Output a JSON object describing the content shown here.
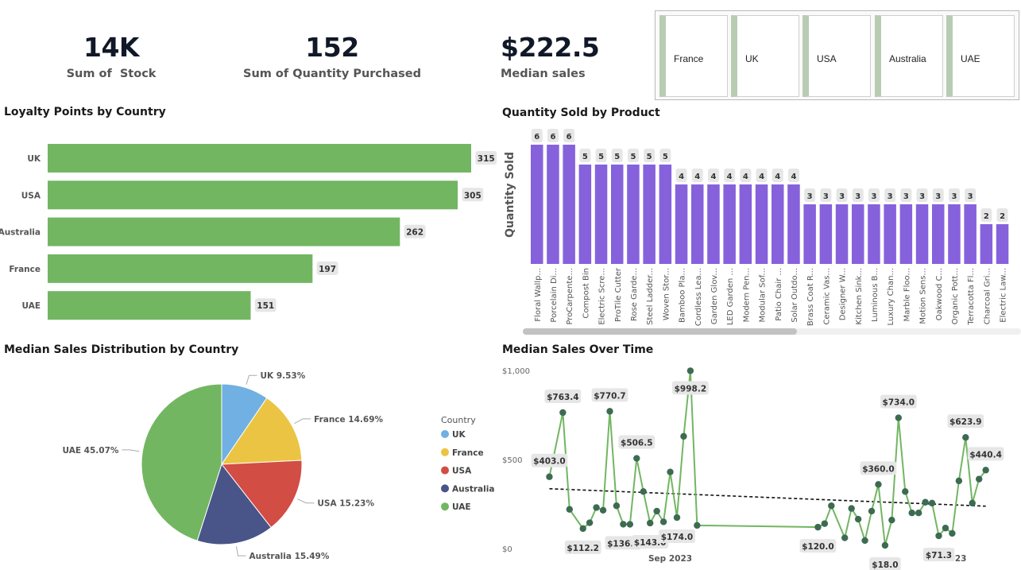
{
  "kpis": {
    "stock": {
      "value": "14K",
      "label": "Sum of  Stock"
    },
    "quantity": {
      "value": "152",
      "label": "Sum of Quantity Purchased"
    },
    "median": {
      "value": "$222.5",
      "label": "Median sales"
    }
  },
  "slicer": {
    "items": [
      "France",
      "UK",
      "USA",
      "Australia",
      "UAE"
    ]
  },
  "loyalty": {
    "title": "Loyalty Points by Country",
    "chart_data": {
      "type": "bar",
      "orientation": "horizontal",
      "categories": [
        "UK",
        "USA",
        "Australia",
        "France",
        "UAE"
      ],
      "values": [
        315,
        305,
        262,
        197,
        151
      ],
      "data_labels": [
        "315",
        "305",
        "262",
        "197",
        "151"
      ],
      "color": "#72b662",
      "xlim": [
        0,
        315
      ]
    }
  },
  "quantity_chart": {
    "title": "Quantity Sold by Product",
    "ylabel": "Quantity Sold",
    "chart_data": {
      "type": "bar",
      "categories": [
        "Floral Wallp...",
        "Porcelain Di...",
        "ProCarpente...",
        "Compost Bin",
        "Electric Scre...",
        "ProTile Cutter",
        "Rose Garde...",
        "Steel Ladder...",
        "Woven Stor...",
        "Bamboo Pla...",
        "Cordless Lea...",
        "Garden Glov...",
        "LED Garden ...",
        "Modern Pen...",
        "Modular Sof...",
        "Patio Chair ...",
        "Solar Outdo...",
        "Brass Coat R...",
        "Ceramic Vas...",
        "Designer W...",
        "Kitchen Sink...",
        "Luminous B...",
        "Luxury Chan...",
        "Marble Floo...",
        "Motion Sens...",
        "Oakwood C...",
        "Organic Pott...",
        "Terracotta Fl...",
        "Charcoal Gri...",
        "Electric Law..."
      ],
      "values": [
        6,
        6,
        6,
        5,
        5,
        5,
        5,
        5,
        5,
        4,
        4,
        4,
        4,
        4,
        4,
        4,
        4,
        3,
        3,
        3,
        3,
        3,
        3,
        3,
        3,
        3,
        3,
        3,
        2,
        2
      ],
      "color": "#8661dc",
      "ylim": [
        0,
        6
      ]
    }
  },
  "pie_chart": {
    "title": "Median Sales Distribution by Country",
    "legend_title": "Country",
    "chart_data": {
      "type": "pie",
      "legend_position": "right",
      "slices": [
        {
          "name": "UK",
          "value": 9.53,
          "label": "UK 9.53%",
          "color": "#71b0e2"
        },
        {
          "name": "France",
          "value": 14.69,
          "label": "France 14.69%",
          "color": "#ecc443"
        },
        {
          "name": "USA",
          "value": 15.23,
          "label": "USA 15.23%",
          "color": "#d24d44"
        },
        {
          "name": "Australia",
          "value": 15.49,
          "label": "Australia 15.49%",
          "color": "#495488"
        },
        {
          "name": "UAE",
          "value": 45.07,
          "label": "UAE 45.07%",
          "color": "#72b662"
        }
      ]
    }
  },
  "line_chart": {
    "title": "Median Sales Over Time",
    "chart_data": {
      "type": "line",
      "y_ticks": [
        "$1,000",
        "$500",
        "$0"
      ],
      "x_ticks": [
        "Sep 2023",
        "Oct 2023"
      ],
      "ylim": [
        0,
        1000
      ],
      "xlim": [
        "2023-08-20",
        "2023-10-28"
      ],
      "line_color": "#72b662",
      "marker_color": "#3d6b52",
      "trend": {
        "start": 336,
        "end": 238,
        "color": "#111111"
      },
      "points": [
        {
          "date": "2023-08-21",
          "value": 403.0,
          "label": "$403.0"
        },
        {
          "date": "2023-08-23",
          "value": 763.4,
          "label": "$763.4"
        },
        {
          "date": "2023-08-24",
          "value": 220
        },
        {
          "date": "2023-08-26",
          "value": 112.2,
          "label": "$112.2"
        },
        {
          "date": "2023-08-27",
          "value": 145
        },
        {
          "date": "2023-08-28",
          "value": 230
        },
        {
          "date": "2023-08-29",
          "value": 215
        },
        {
          "date": "2023-08-30",
          "value": 770.7,
          "label": "$770.7"
        },
        {
          "date": "2023-08-31",
          "value": 240
        },
        {
          "date": "2023-09-01",
          "value": 136.5,
          "label": "$136.5"
        },
        {
          "date": "2023-09-02",
          "value": 136
        },
        {
          "date": "2023-09-03",
          "value": 506.5,
          "label": "$506.5"
        },
        {
          "date": "2023-09-04",
          "value": 320
        },
        {
          "date": "2023-09-05",
          "value": 143.0,
          "label": "$143.0"
        },
        {
          "date": "2023-09-06",
          "value": 210
        },
        {
          "date": "2023-09-07",
          "value": 150
        },
        {
          "date": "2023-09-08",
          "value": 430
        },
        {
          "date": "2023-09-09",
          "value": 174.0,
          "label": "$174.0"
        },
        {
          "date": "2023-09-10",
          "value": 630
        },
        {
          "date": "2023-09-11",
          "value": 998.2,
          "label": "$998.2"
        },
        {
          "date": "2023-09-12",
          "value": 130
        },
        {
          "date": "2023-09-30",
          "value": 120.0,
          "label": "$120.0"
        },
        {
          "date": "2023-10-01",
          "value": 140
        },
        {
          "date": "2023-10-02",
          "value": 240
        },
        {
          "date": "2023-10-04",
          "value": 60
        },
        {
          "date": "2023-10-05",
          "value": 225
        },
        {
          "date": "2023-10-06",
          "value": 165
        },
        {
          "date": "2023-10-07",
          "value": 45
        },
        {
          "date": "2023-10-08",
          "value": 210
        },
        {
          "date": "2023-10-09",
          "value": 360.0,
          "label": "$360.0"
        },
        {
          "date": "2023-10-10",
          "value": 18.0,
          "label": "$18.0"
        },
        {
          "date": "2023-10-11",
          "value": 160
        },
        {
          "date": "2023-10-12",
          "value": 734.0,
          "label": "$734.0"
        },
        {
          "date": "2023-10-13",
          "value": 320
        },
        {
          "date": "2023-10-14",
          "value": 200
        },
        {
          "date": "2023-10-15",
          "value": 200
        },
        {
          "date": "2023-10-16",
          "value": 260
        },
        {
          "date": "2023-10-17",
          "value": 255
        },
        {
          "date": "2023-10-18",
          "value": 71.3,
          "label": "$71.3"
        },
        {
          "date": "2023-10-19",
          "value": 115
        },
        {
          "date": "2023-10-20",
          "value": 85
        },
        {
          "date": "2023-10-21",
          "value": 380
        },
        {
          "date": "2023-10-22",
          "value": 623.9,
          "label": "$623.9"
        },
        {
          "date": "2023-10-23",
          "value": 255
        },
        {
          "date": "2023-10-24",
          "value": 390
        },
        {
          "date": "2023-10-25",
          "value": 440.4,
          "label": "$440.4"
        }
      ]
    }
  }
}
